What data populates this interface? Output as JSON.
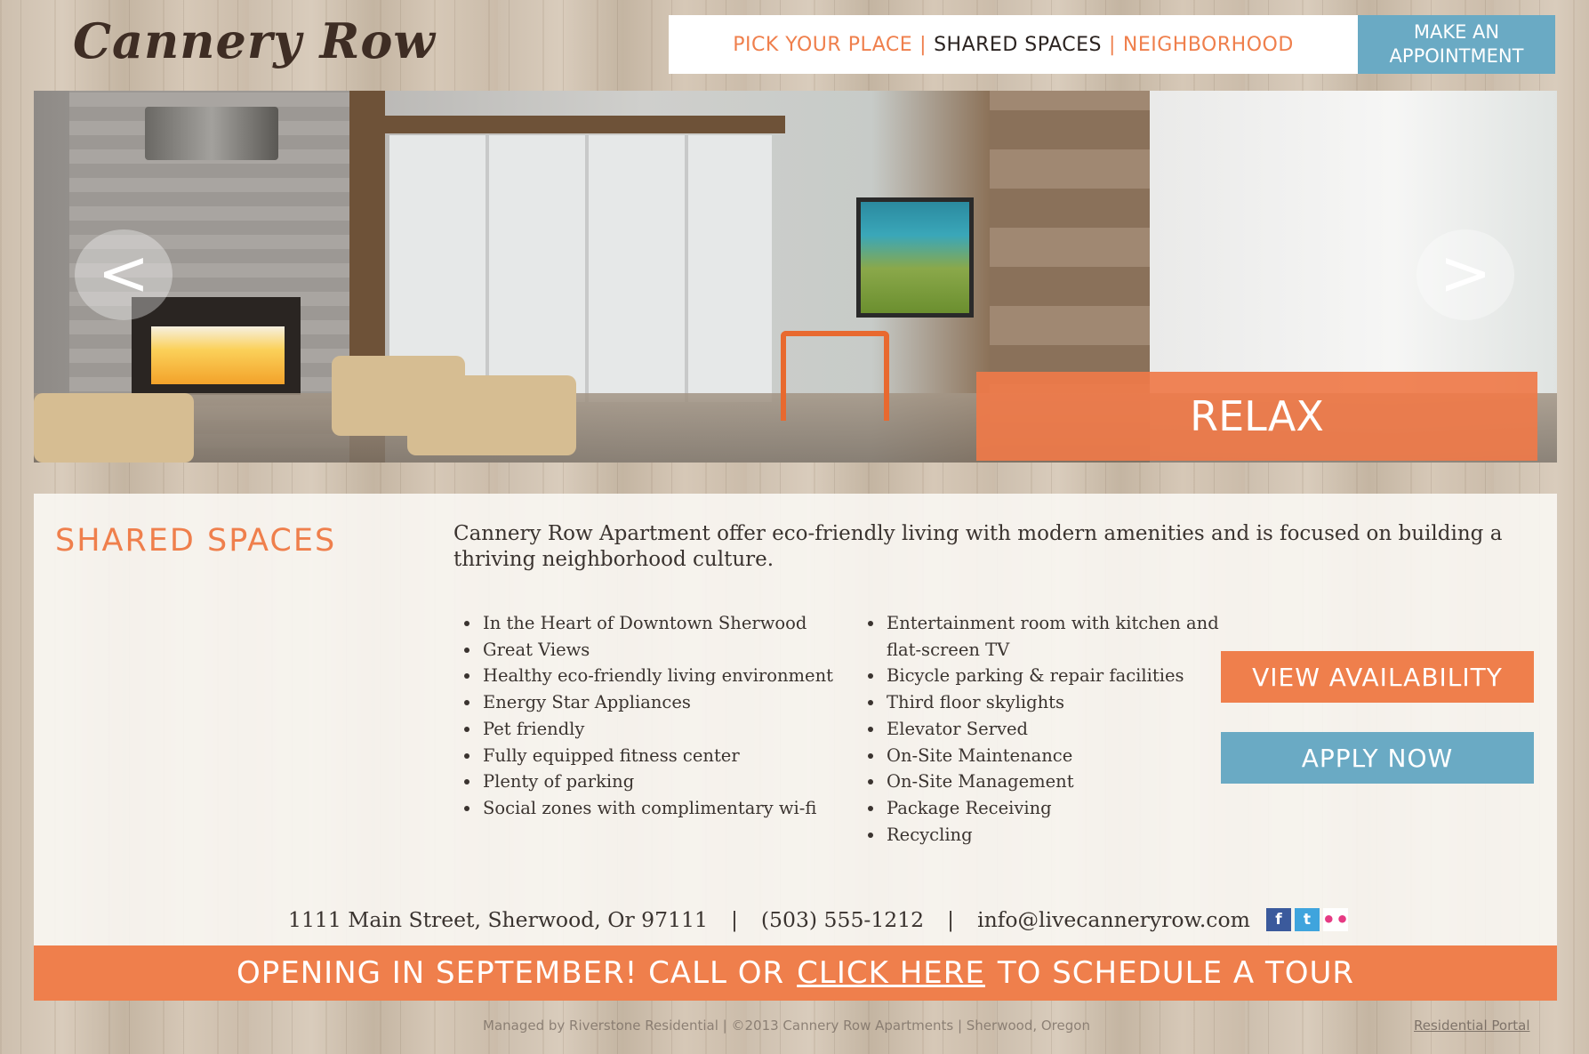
{
  "brand": {
    "logo_text": "Cannery Row"
  },
  "nav": {
    "items": [
      {
        "label": "PICK YOUR PLACE",
        "active": false
      },
      {
        "label": "SHARED SPACES",
        "active": true
      },
      {
        "label": "NEIGHBORHOOD",
        "active": false
      }
    ],
    "separator": "|",
    "appointment_label": "MAKE AN\nAPPOINTMENT"
  },
  "hero": {
    "caption": "RELAX",
    "prev_icon": "chevron-left-icon",
    "next_icon": "chevron-right-icon",
    "prev_glyph": "<",
    "next_glyph": ">"
  },
  "main": {
    "section_title": "SHARED SPACES",
    "intro": "Cannery Row Apartment offer  eco-friendly living with modern amenities and is focused on building a thriving neighborhood culture.",
    "amenities_left": [
      "In the Heart of Downtown Sherwood",
      "Great Views",
      "Healthy eco-friendly living environment",
      "Energy Star Appliances",
      "Pet friendly",
      "Fully equipped fitness center",
      "Plenty of parking",
      "Social zones with complimentary wi-fi"
    ],
    "amenities_right": [
      "Entertainment room with kitchen and flat-screen TV",
      "Bicycle parking & repair facilities",
      "Third floor skylights",
      "Elevator Served",
      "On-Site Maintenance",
      "On-Site Management",
      "Package Receiving",
      "Recycling"
    ],
    "view_availability_label": "VIEW AVAILABILITY",
    "apply_now_label": "APPLY NOW"
  },
  "contact": {
    "address": "1111 Main Street,  Sherwood, Or 97111",
    "phone": "(503) 555-1212",
    "email": "info@livecanneryrow.com",
    "separator": "|",
    "social": [
      {
        "icon": "facebook-icon",
        "glyph": "f"
      },
      {
        "icon": "twitter-icon",
        "glyph": "t"
      },
      {
        "icon": "flickr-icon",
        "glyph": "••"
      }
    ]
  },
  "banner": {
    "prefix": "OPENING IN SEPTEMBER! CALL OR",
    "link": "CLICK HERE",
    "suffix": "TO SCHEDULE A TOUR"
  },
  "footer": {
    "text": "Managed by Riverstone Residential  |  ©2013 Cannery Row Apartments  |  Sherwood, Oregon",
    "link": "Residential Portal"
  },
  "colors": {
    "accent_orange": "#ef7f4c",
    "accent_blue": "#6aaac4",
    "text_dark": "#3a332f"
  }
}
